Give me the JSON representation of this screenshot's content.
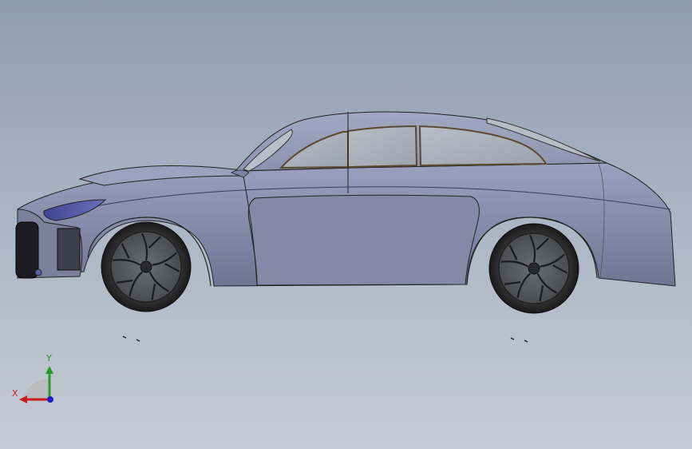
{
  "viewport": {
    "background_top": "#8e9cb0",
    "background_bottom": "#c6ccd6"
  },
  "model": {
    "subject": "car-body-side-view",
    "body_color": "#8a90ac",
    "window_color": "#a9b0b8",
    "headlight_color": "#4f55a0"
  },
  "triad": {
    "x_label": "X",
    "y_label": "Y",
    "x_color": "#c81e1e",
    "y_color": "#1ea01e",
    "z_color": "#1e1ec8"
  }
}
